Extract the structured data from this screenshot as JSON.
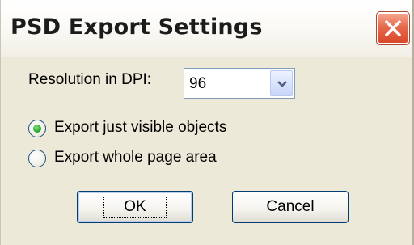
{
  "window": {
    "title": "PSD Export Settings"
  },
  "resolution": {
    "label": "Resolution in DPI:",
    "value": "96"
  },
  "export_options": [
    {
      "label": "Export just visible objects",
      "selected": true
    },
    {
      "label": "Export whole page area",
      "selected": false
    }
  ],
  "buttons": {
    "ok_label": "OK",
    "cancel_label": "Cancel"
  },
  "icons": {
    "close": "close-icon",
    "dropdown": "chevron-down-icon"
  },
  "colors": {
    "dialog_bg": "#ece9d8",
    "close_button": "#d9472a",
    "radio_selected": "#21a121",
    "button_border": "#003c74"
  }
}
